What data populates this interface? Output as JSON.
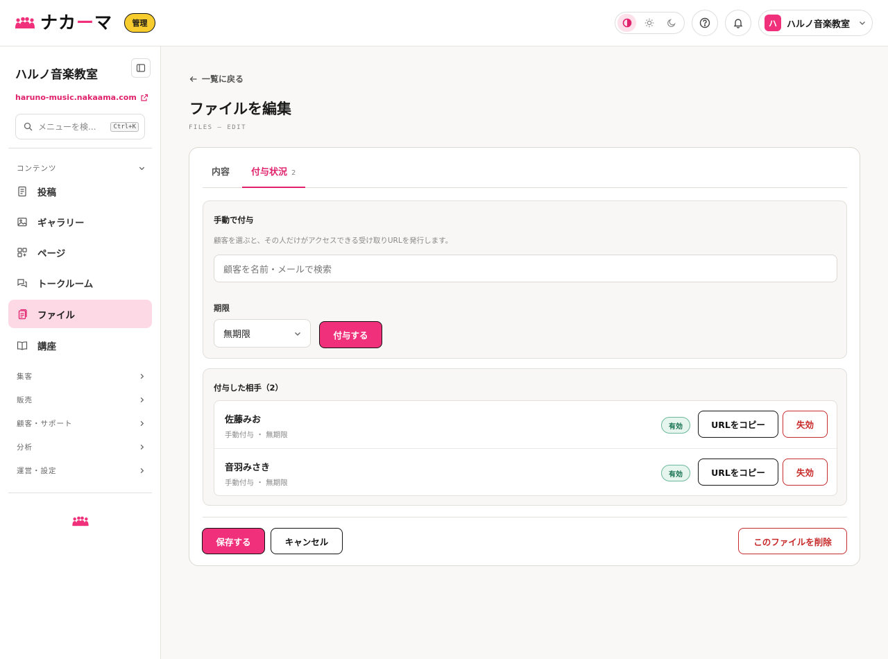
{
  "topbar": {
    "logo_text": "ナカーマ",
    "admin_badge": "管理",
    "theme_options": [
      "contrast-icon",
      "sun-icon",
      "moon-icon"
    ],
    "account_avatar": "ハ",
    "account_name": "ハルノ音楽教室"
  },
  "sidebar": {
    "site_name": "ハルノ音楽教室",
    "site_url": "haruno-music.nakaama.com",
    "search_placeholder": "メニューを検...",
    "search_shortcut": "Ctrl+K",
    "content_section": "コンテンツ",
    "nav_items": [
      {
        "label": "投稿",
        "icon": "document-icon"
      },
      {
        "label": "ギャラリー",
        "icon": "image-icon"
      },
      {
        "label": "ページ",
        "icon": "pages-icon"
      },
      {
        "label": "トークルーム",
        "icon": "chat-icon"
      },
      {
        "label": "ファイル",
        "icon": "file-icon",
        "active": true
      },
      {
        "label": "講座",
        "icon": "book-icon"
      }
    ],
    "sections": [
      "集客",
      "販売",
      "顧客・サポート",
      "分析",
      "運営・設定"
    ]
  },
  "main": {
    "back_link": "一覧に戻る",
    "page_title": "ファイルを編集",
    "page_subtitle": "FILES — EDIT",
    "tabs": [
      {
        "label": "内容",
        "count": ""
      },
      {
        "label": "付与状況",
        "count": "2",
        "active": true
      }
    ],
    "manual_grant": {
      "title": "手動で付与",
      "description": "顧客を選ぶと、その人だけがアクセスできる受け取りURLを発行します。",
      "customer_placeholder": "顧客を名前・メールで検索",
      "expiry_label": "期限",
      "expiry_value": "無期限",
      "grant_button": "付与する"
    },
    "recipients": {
      "title": "付与した相手（2）",
      "items": [
        {
          "name": "佐藤みお",
          "meta": "手動付与 ・ 無期限",
          "status": "有効",
          "copy_label": "URLをコピー",
          "revoke_label": "失効"
        },
        {
          "name": "音羽みさき",
          "meta": "手動付与 ・ 無期限",
          "status": "有効",
          "copy_label": "URLをコピー",
          "revoke_label": "失効"
        }
      ]
    },
    "footer": {
      "save": "保存する",
      "cancel": "キャンセル",
      "delete": "このファイルを削除"
    }
  },
  "colors": {
    "accent": "#f0307a",
    "accent_text": "#e0216b",
    "admin_badge": "#f7cc2e",
    "danger": "#c82b2b",
    "success": "#167350"
  }
}
